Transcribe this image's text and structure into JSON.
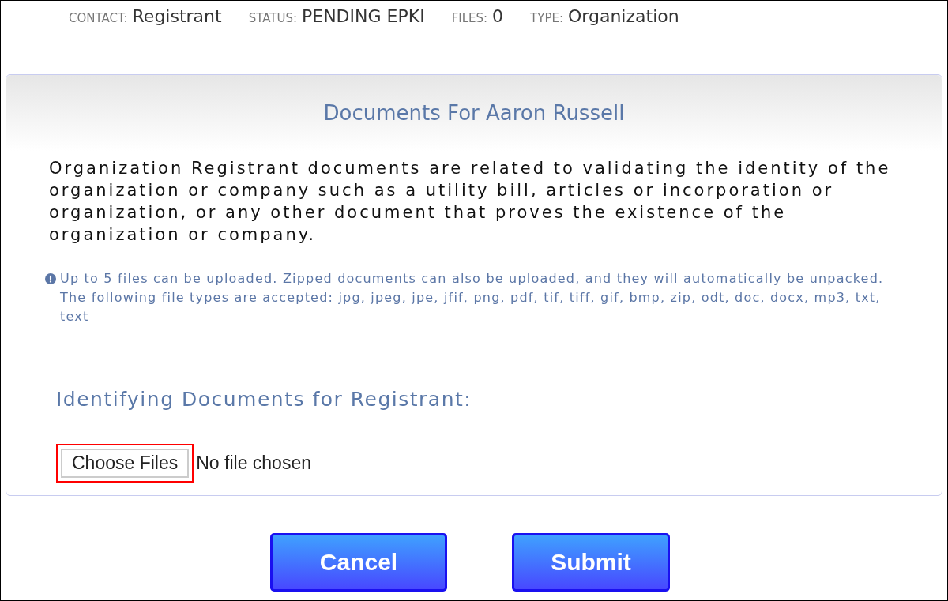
{
  "status_bar": [
    {
      "label": "CONTACT:",
      "value": "Registrant"
    },
    {
      "label": "STATUS:",
      "value": "PENDING EPKI"
    },
    {
      "label": "FILES:",
      "value": "0"
    },
    {
      "label": "TYPE:",
      "value": "Organization"
    }
  ],
  "panel": {
    "title": "Documents For Aaron Russell",
    "description": "Organization Registrant documents are related to validating the identity of the organization or company such as a utility bill, articles or incorporation or organization, or any other document that proves the existence of the organization or company.",
    "note": "Up to 5 files can be uploaded. Zipped documents can also be uploaded, and they will automatically be unpacked. The following file types are accepted: jpg, jpeg, jpe, jfif, png, pdf, tif, tiff, gif, bmp, zip, odt, doc, docx, mp3, txt, text",
    "section_heading": "Identifying Documents for Registrant:",
    "file_input": {
      "button": "Choose Files",
      "status": "No file chosen",
      "highlighted": true
    }
  },
  "buttons": [
    "Cancel",
    "Submit"
  ]
}
